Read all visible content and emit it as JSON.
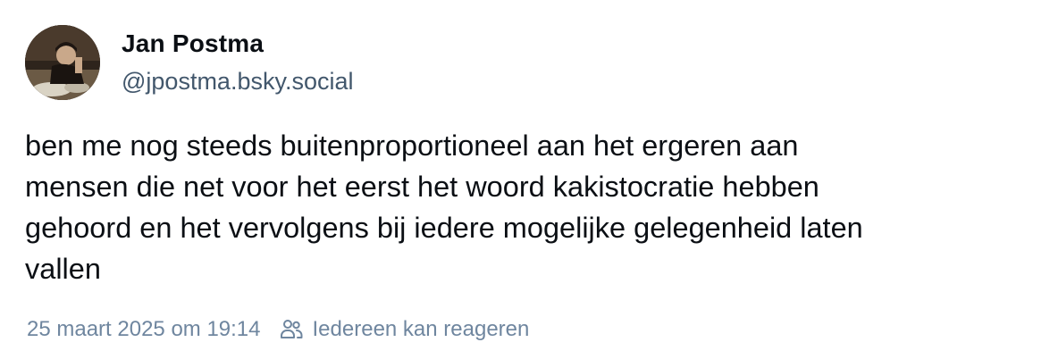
{
  "post": {
    "author": {
      "display_name": "Jan Postma",
      "handle": "@jpostma.bsky.social"
    },
    "text_lines": [
      "ben me nog steeds buitenproportioneel aan het ergeren aan",
      "mensen die net voor het eerst het woord kakistocratie hebben",
      "gehoord en het vervolgens bij iedere mogelijke gelegenheid laten",
      "vallen"
    ],
    "timestamp": "25 maart 2025 om 19:14",
    "reply_setting": "Iedereen kan reageren",
    "icons": {
      "reply_setting_icon": "people-icon"
    }
  },
  "colors": {
    "text": "#0b0f14",
    "handle": "#42576c",
    "meta": "#6f869f"
  }
}
